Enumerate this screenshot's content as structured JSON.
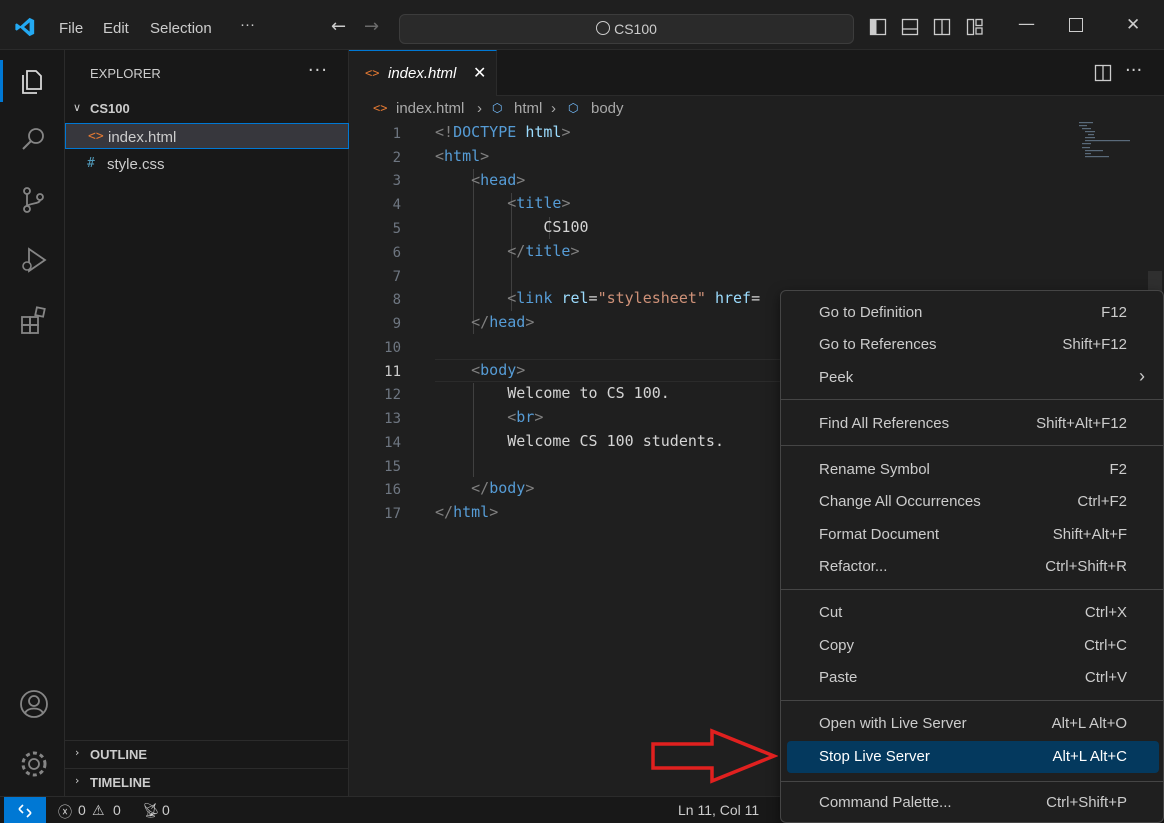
{
  "titlebar": {
    "menus": [
      "File",
      "Edit",
      "Selection",
      "···"
    ],
    "search": "CS100"
  },
  "sidebar": {
    "title": "EXPLORER",
    "more": "···",
    "folder": "CS100",
    "files": [
      {
        "name": "index.html",
        "icon": "<>",
        "icon_color": "#e37933"
      },
      {
        "name": "style.css",
        "icon": "#",
        "icon_color": "#519aba"
      }
    ],
    "panels": [
      "OUTLINE",
      "TIMELINE"
    ]
  },
  "tabs": [
    {
      "name": "index.html",
      "icon": "<>",
      "close": "✕"
    }
  ],
  "breadcrumb": [
    "index.html",
    "html",
    "body"
  ],
  "editor": {
    "line_numbers": [
      "1",
      "2",
      "3",
      "4",
      "5",
      "6",
      "7",
      "8",
      "9",
      "10",
      "11",
      "12",
      "13",
      "14",
      "15",
      "16",
      "17"
    ],
    "active_line": 11
  },
  "statusbar": {
    "errors": "0",
    "warnings": "0",
    "ports": "0",
    "position": "Ln 11, Col 11"
  },
  "context_menu": {
    "items": [
      {
        "label": "Go to Definition",
        "key": "F12"
      },
      {
        "label": "Go to References",
        "key": "Shift+F12"
      },
      {
        "label": "Peek",
        "key": "›"
      },
      {
        "label": "Find All References",
        "key": "Shift+Alt+F12"
      },
      {
        "label": "Rename Symbol",
        "key": "F2"
      },
      {
        "label": "Change All Occurrences",
        "key": "Ctrl+F2"
      },
      {
        "label": "Format Document",
        "key": "Shift+Alt+F"
      },
      {
        "label": "Refactor...",
        "key": "Ctrl+Shift+R"
      },
      {
        "label": "Cut",
        "key": "Ctrl+X"
      },
      {
        "label": "Copy",
        "key": "Ctrl+C"
      },
      {
        "label": "Paste",
        "key": "Ctrl+V"
      },
      {
        "label": "Open with Live Server",
        "key": "Alt+L Alt+O"
      },
      {
        "label": "Stop Live Server",
        "key": "Alt+L Alt+C"
      },
      {
        "label": "Command Palette...",
        "key": "Ctrl+Shift+P"
      }
    ],
    "highlighted": "Stop Live Server"
  },
  "colors": {
    "accent": "#0078d4",
    "menu_highlight": "#04395e",
    "annotation_arrow": "#e0201f"
  }
}
